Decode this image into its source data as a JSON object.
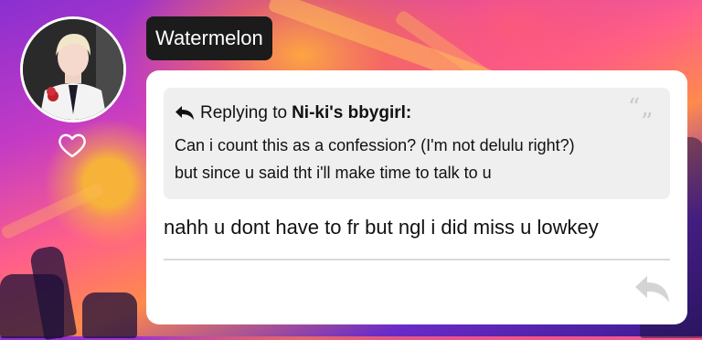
{
  "post": {
    "author": "Watermelon",
    "reply": {
      "prefix": "Replying to",
      "target": "Ni-ki's bbygirl:",
      "lines": [
        "Can i count this as a confession? (I'm not delulu right?)",
        "but since u said tht i'll make time to talk to u"
      ]
    },
    "message": "nahh u dont have to fr but ngl i did miss u lowkey"
  },
  "icons": {
    "like": "heart-icon",
    "reply_marker": "reply-arrow-icon",
    "quote": "quote-icon",
    "reply_action": "reply-arrow-icon"
  },
  "colors": {
    "name_tag_bg": "#1b1b1b",
    "card_bg": "#ffffff",
    "quote_box_bg": "#efefef"
  }
}
